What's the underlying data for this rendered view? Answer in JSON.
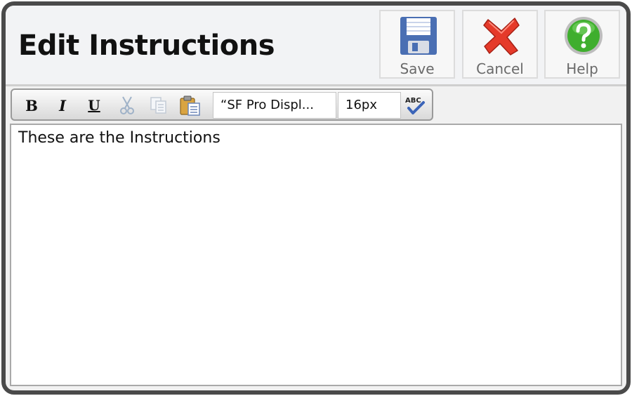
{
  "header": {
    "title": "Edit Instructions",
    "buttons": {
      "save_label": "Save",
      "cancel_label": "Cancel",
      "help_label": "Help"
    }
  },
  "toolbar": {
    "bold_label": "B",
    "italic_label": "I",
    "underline_label": "U",
    "font_family": "“SF Pro Displ...",
    "font_size": "16px",
    "spellcheck_glyph": "ABC"
  },
  "editor": {
    "content": "These are the Instructions"
  },
  "colors": {
    "frame": "#4a4a4a",
    "save_icon": "#4a6fb3",
    "cancel_icon": "#e53a2a",
    "help_icon": "#3fae2e"
  },
  "icons": [
    "floppy-disk-icon",
    "red-x-icon",
    "help-question-icon",
    "scissors-icon",
    "copy-icon",
    "paste-icon",
    "spellcheck-icon"
  ]
}
